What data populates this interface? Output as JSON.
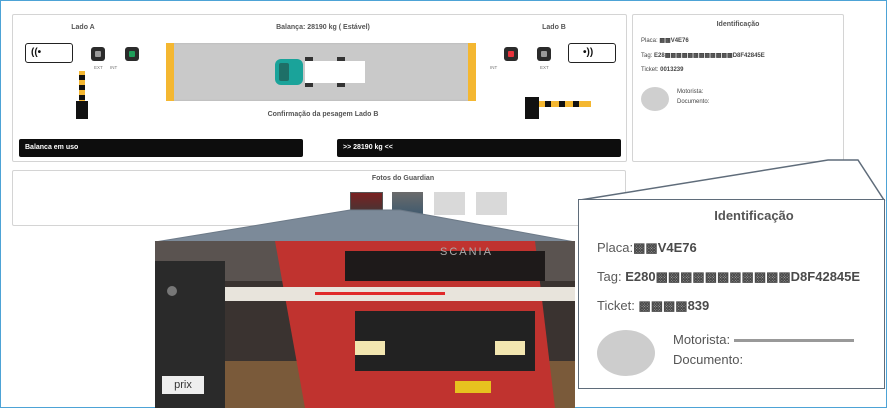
{
  "scale": {
    "side_a_label": "Lado A",
    "side_b_label": "Lado B",
    "balance_status": "Balança: 28190 kg ( Estável)",
    "confirmation_text": "Confirmação da pesagem Lado B",
    "ext_label": "EXT",
    "int_label": "INT",
    "status_bar_text": "Balanca em uso",
    "weight_bar_text": ">> 28190 kg <<",
    "sensor_a_symbol": "((•",
    "sensor_b_symbol": "•))",
    "colors": {
      "lamp_red": "#e8323c",
      "lamp_green": "#1f9e5a",
      "truck_cab": "#1aa39a",
      "rail": "#f4b731"
    }
  },
  "photos": {
    "title": "Fotos do Guardian",
    "thumbnails": [
      "photo-1",
      "photo-2",
      "photo-3",
      "photo-4"
    ]
  },
  "identification": {
    "title": "Identificação",
    "plate_label": "Placa:",
    "plate_value": "▩▩V4E76",
    "tag_label": "Tag:",
    "tag_value": "E280▩▩▩▩▩▩▩▩▩▩▩D8F42845E",
    "ticket_label": "Ticket:",
    "ticket_value": "▩▩▩▩839",
    "driver_label": "Motorista:",
    "document_label": "Documento:",
    "small_plate_value": "▩▩V4E76",
    "small_tag_value": "E28▩▩▩▩▩▩▩▩▩▩▩▩D8F42845E",
    "small_ticket_value": "0013239"
  },
  "photo_zoom": {
    "camera_brand": "prix",
    "truck_logo": "SCANIA"
  }
}
